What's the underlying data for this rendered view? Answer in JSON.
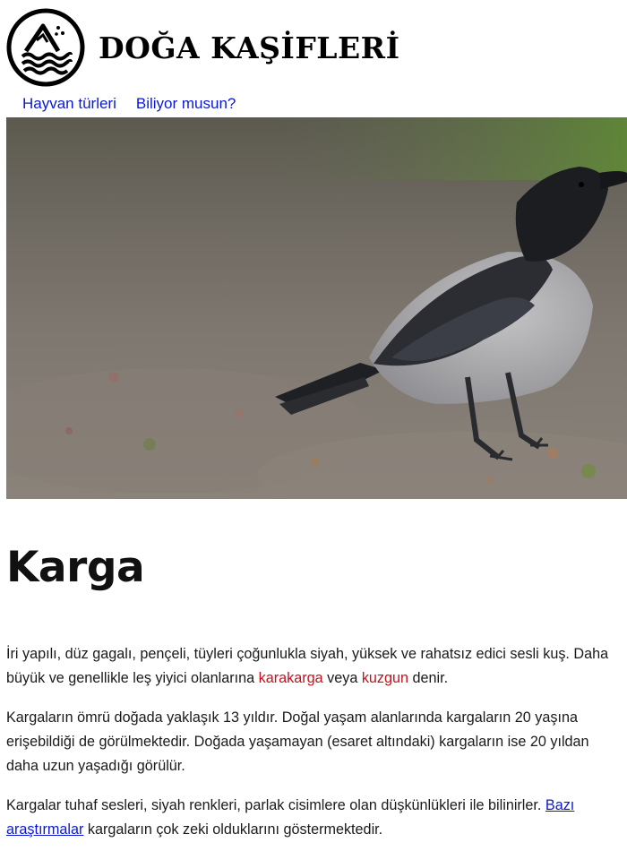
{
  "site": {
    "title": "DOĞA KAŞİFLERİ"
  },
  "nav": {
    "items": [
      {
        "label": "Hayvan türleri"
      },
      {
        "label": "Biliyor musun?"
      }
    ]
  },
  "article": {
    "title": "Karga",
    "p1": {
      "text_a": "İri yapılı, düz gagalı, pençeli, tüyleri çoğunlukla siyah, yüksek ve rahatsız edici sesli kuş. Daha büyük ve genellikle leş yiyici olanlarına ",
      "link1": "karakarga",
      "text_b": " veya ",
      "link2": "kuzgun",
      "text_c": " denir."
    },
    "p2": {
      "text": "Kargaların ömrü doğada yaklaşık 13 yıldır. Doğal yaşam alanlarında kargaların 20 yaşına erişebildiği de görülmektedir. Doğada yaşamayan (esaret altındaki) kargaların ise 20 yıldan daha uzun yaşadığı görülür."
    },
    "p3": {
      "text_a": "Kargalar tuhaf sesleri, siyah renkleri, parlak cisimlere olan düşkünlükleri ile bilinirler. ",
      "link": "Bazı araştırmalar",
      "text_b": " kargaların çok zeki olduklarını göstermektedir."
    }
  },
  "colors": {
    "nav_link": "#0a18d6",
    "internal_link": "#c8101c"
  },
  "icons": {
    "logo": "mountain-waves-logo-icon"
  }
}
